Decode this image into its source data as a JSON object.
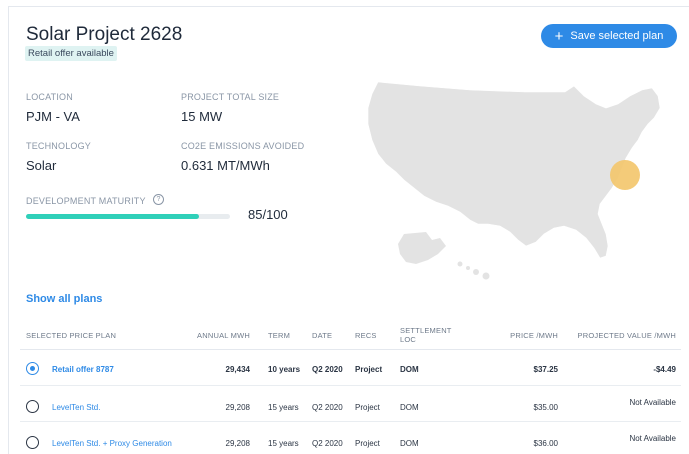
{
  "project": {
    "title": "Solar Project 2628",
    "badge": "Retail offer available",
    "save_button": "Save selected plan"
  },
  "details": {
    "location_label": "LOCATION",
    "location_value": "PJM - VA",
    "size_label": "PROJECT TOTAL SIZE",
    "size_value": "15 MW",
    "technology_label": "TECHNOLOGY",
    "technology_value": "Solar",
    "emissions_label": "CO2E EMISSIONS AVOIDED",
    "emissions_value": "0.631 MT/MWh",
    "maturity_label": "DEVELOPMENT MATURITY",
    "maturity_score": "85/100",
    "maturity_fraction": 0.85
  },
  "show_all_plans": "Show all plans",
  "table": {
    "headers": {
      "plan": "SELECTED PRICE PLAN",
      "annual": "ANNUAL MWH",
      "term": "TERM",
      "date": "DATE",
      "recs": "RECS",
      "settlement": "SETTLEMENT LOC",
      "price": "PRICE /MWH",
      "projected": "PROJECTED VALUE /MWH"
    },
    "rows": [
      {
        "selected": true,
        "plan": "Retail offer 8787",
        "annual": "29,434",
        "term": "10 years",
        "date": "Q2 2020",
        "recs": "Project",
        "settlement": "DOM",
        "price": "$37.25",
        "projected": "-$4.49"
      },
      {
        "selected": false,
        "plan": "LevelTen Std.",
        "annual": "29,208",
        "term": "15 years",
        "date": "Q2 2020",
        "recs": "Project",
        "settlement": "DOM",
        "price": "$35.00",
        "projected": "Not Available"
      },
      {
        "selected": false,
        "plan": "LevelTen Std. + Proxy Generation",
        "annual": "29,208",
        "term": "15 years",
        "date": "Q2 2020",
        "recs": "Project",
        "settlement": "DOM",
        "price": "$36.00",
        "projected": "Not Available"
      }
    ]
  },
  "colors": {
    "accent": "#2e8ae6",
    "progress": "#2fd0b9",
    "map_land": "#e3e3e3",
    "marker": "#f3c56a"
  },
  "icons": {
    "save": "plus-icon",
    "info": "info-icon",
    "radio_on": "radio-selected-icon",
    "radio_off": "radio-unselected-icon"
  }
}
